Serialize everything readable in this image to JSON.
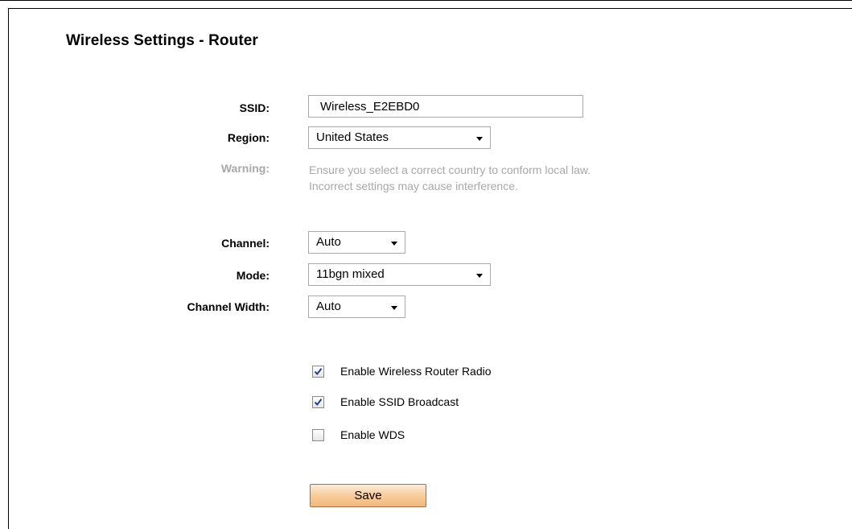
{
  "page": {
    "title": "Wireless Settings - Router"
  },
  "form": {
    "ssid_label": "SSID:",
    "ssid_value": "Wireless_E2EBD0",
    "region_label": "Region:",
    "region_value": "United States",
    "warning_label": "Warning:",
    "warning_line1": "Ensure you select a correct country to conform local law.",
    "warning_line2": "Incorrect settings may cause interference.",
    "channel_label": "Channel:",
    "channel_value": "Auto",
    "mode_label": "Mode:",
    "mode_value": "11bgn mixed",
    "channel_width_label": "Channel Width:",
    "channel_width_value": "Auto"
  },
  "options": [
    {
      "label": "Enable Wireless Router Radio",
      "checked": true
    },
    {
      "label": "Enable SSID Broadcast",
      "checked": true
    },
    {
      "label": "Enable WDS",
      "checked": false
    }
  ],
  "actions": {
    "save_label": "Save"
  },
  "colors": {
    "warning_text": "#a8a8a8",
    "save_button": "#f8cfa0",
    "checkmark": "#1f3f8f"
  },
  "icons": {
    "dropdown": "chevron-down-icon",
    "check": "checkmark-icon"
  }
}
